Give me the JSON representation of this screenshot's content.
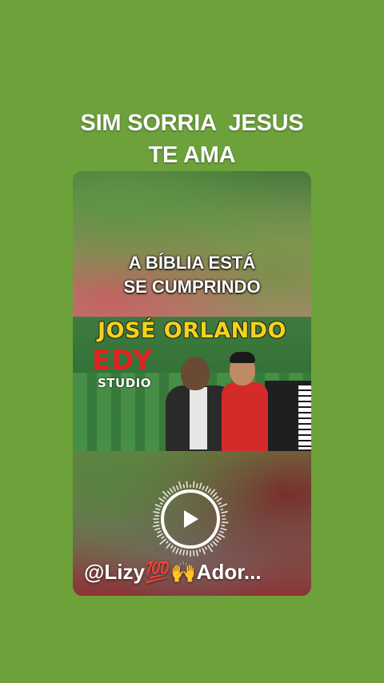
{
  "headline": {
    "line1": "SIM SORRIA  JESUS",
    "line2": "TE AMA"
  },
  "card": {
    "caption_line1": "A BÍBLIA ESTÁ",
    "caption_line2": "SE CUMPRINDO",
    "thumbnail": {
      "title": "JOSÉ ORLANDO",
      "logo": "EDY",
      "logo_sub": "STUDIO"
    },
    "username": "@Lizy💯🙌Ador..."
  },
  "colors": {
    "background": "#6da23b",
    "thumb_title": "#f4d21a",
    "logo_red": "#e02222"
  },
  "icons": {
    "play": "play-icon",
    "sound_ring": "audio-waveform-ring-icon"
  }
}
